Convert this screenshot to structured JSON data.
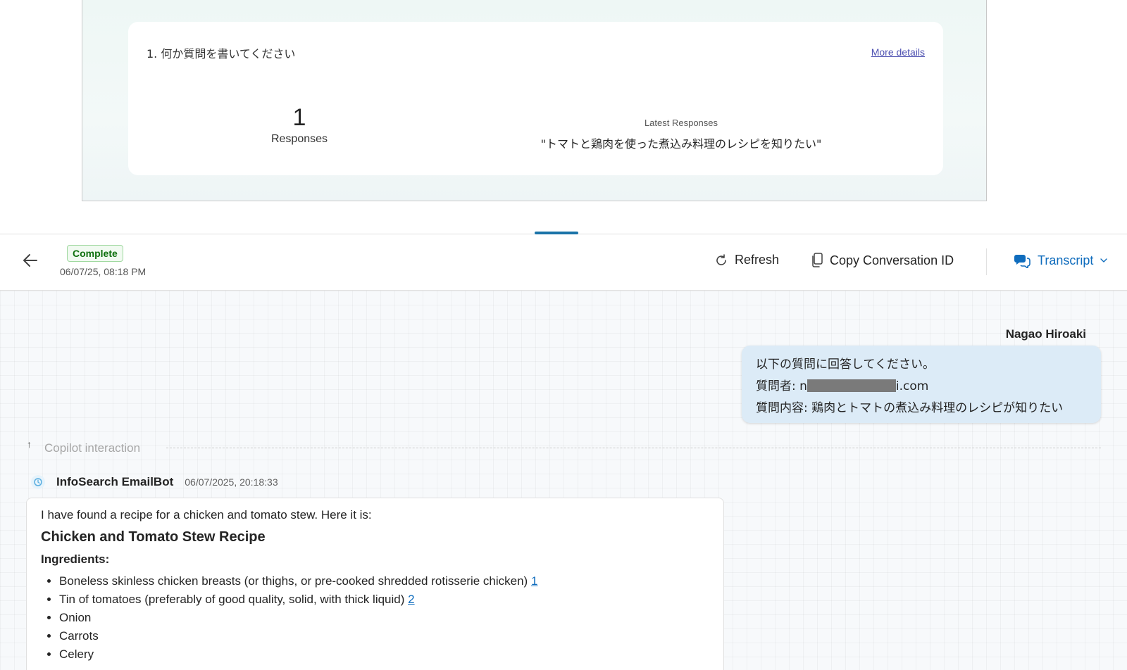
{
  "survey": {
    "question": "1. 何か質問を書いてください",
    "more_details": "More details",
    "response_count": "1",
    "responses_label": "Responses",
    "latest_label": "Latest Responses",
    "latest_text": "\"トマトと鶏肉を使った煮込み料理のレシピを知りたい\""
  },
  "conversation": {
    "status": "Complete",
    "date": "06/07/25, 08:18 PM",
    "refresh_label": "Refresh",
    "copy_label": "Copy Conversation ID",
    "transcript_label": "Transcript"
  },
  "chat": {
    "user_name": "Nagao Hiroaki",
    "user_lines": {
      "line1": "以下の質問に回答してください。",
      "line2_prefix": "質問者: n",
      "line2_suffix": "i.com",
      "line3": "質問内容: 鶏肉とトマトの煮込み料理のレシピが知りたい"
    },
    "copilot_label": "Copilot interaction",
    "bot_name": "InfoSearch EmailBot",
    "bot_time": "06/07/2025, 20:18:33",
    "bot_intro": "I have found a recipe for a chicken and tomato stew. Here it is:",
    "recipe_title": "Chicken and Tomato Stew Recipe",
    "ingredients_head": "Ingredients:",
    "ingredients": [
      {
        "text": "Boneless skinless chicken breasts (or thighs, or pre-cooked shredded rotisserie chicken) ",
        "cite": "1"
      },
      {
        "text": "Tin of tomatoes (preferably of good quality, solid, with thick liquid) ",
        "cite": "2"
      },
      {
        "text": "Onion",
        "cite": ""
      },
      {
        "text": "Carrots",
        "cite": ""
      },
      {
        "text": "Celery",
        "cite": ""
      }
    ]
  }
}
